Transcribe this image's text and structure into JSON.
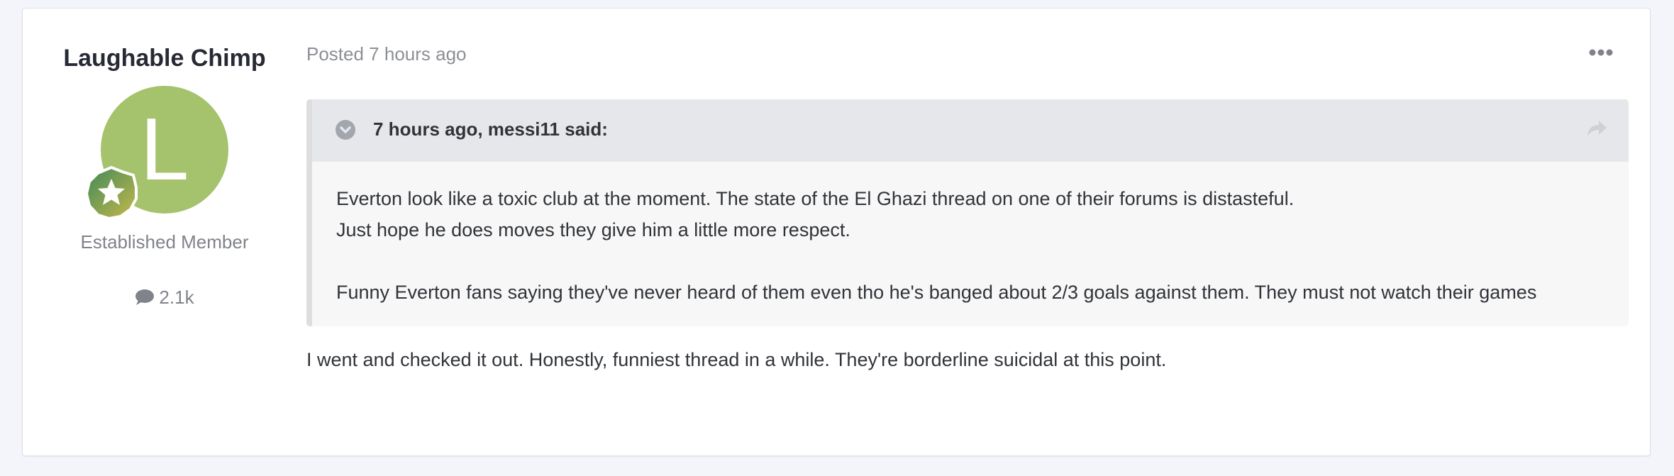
{
  "author": {
    "name": "Laughable Chimp",
    "avatar_letter": "L",
    "avatar_color": "#a5c26d",
    "rank_title": "Established Member",
    "post_count": "2.1k",
    "rank_badge_icon": "star-badge-icon",
    "count_icon": "comment-icon"
  },
  "post": {
    "meta": "Posted 7 hours ago",
    "menu_icon": "more-options-icon",
    "quote": {
      "citation": "7 hours ago, messi11 said:",
      "toggle_icon": "chevron-down-icon",
      "share_icon": "share-arrow-icon",
      "lines": [
        "Everton look like a toxic club at the moment. The state of the El Ghazi thread on one of their forums is distasteful.",
        "Just hope he does moves they give him a little more respect.",
        "Funny Everton fans saying they've never heard of them even tho he's banged about 2/3 goals against them. They must not watch their games"
      ]
    },
    "reply": "I went and checked it out. Honestly, funniest thread in a while. They're borderline suicidal at this point."
  }
}
